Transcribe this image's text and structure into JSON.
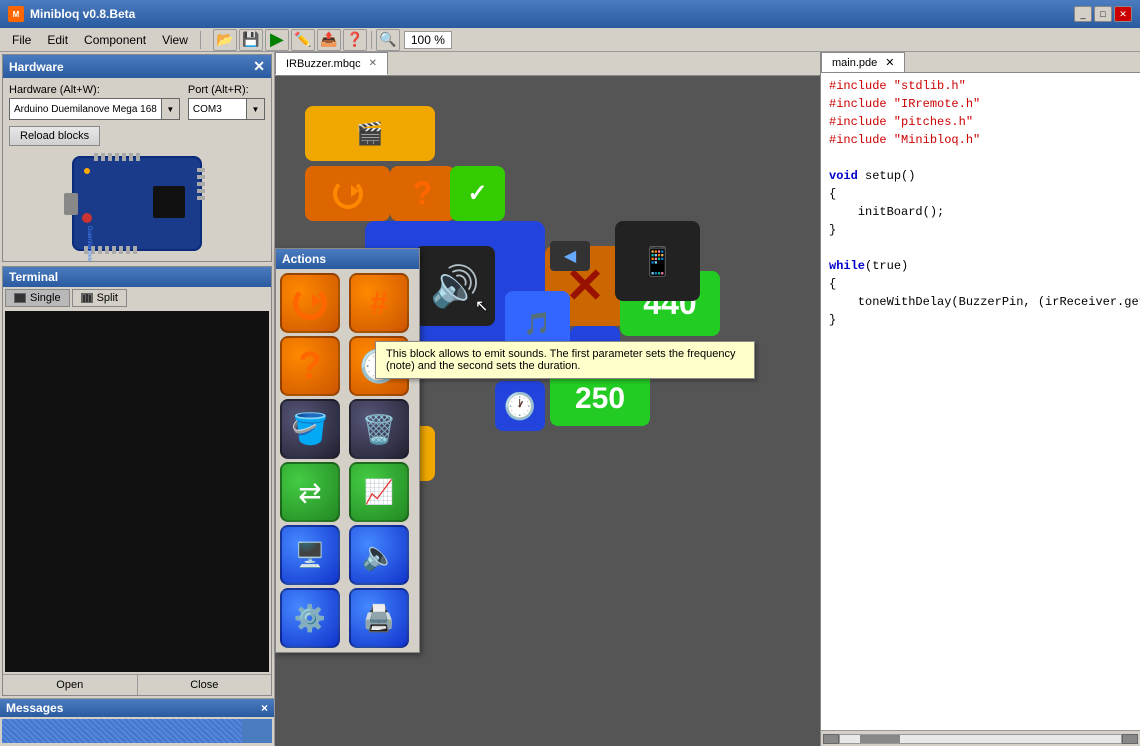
{
  "titlebar": {
    "title": "Minibloq v0.8.Beta",
    "icon": "🔧"
  },
  "menubar": {
    "items": [
      "File",
      "Edit",
      "Component",
      "View"
    ]
  },
  "toolbar": {
    "zoom": "100 %"
  },
  "hardware": {
    "title": "Hardware",
    "hw_label": "Hardware (Alt+W):",
    "hw_value": "Arduino Duemilanove Mega 168",
    "port_label": "Port (Alt+R):",
    "port_value": "COM3",
    "reload_label": "Reload blocks"
  },
  "terminal": {
    "title": "Terminal",
    "tab_single": "Single",
    "tab_split": "Split",
    "btn_open": "Open",
    "btn_close": "Close"
  },
  "messages": {
    "title": "Messages",
    "close": "×"
  },
  "tabs": {
    "editor_tab": "IRBuzzer.mbqc",
    "code_tab": "main.pde"
  },
  "actions": {
    "title": "Actions"
  },
  "code": {
    "lines": [
      "#include \"stdlib.h\"",
      "#include \"IRremote.h\"",
      "#include \"pitches.h\"",
      "#include \"Minibloq.h\"",
      "",
      "void setup()",
      "{",
      "    initBoard();",
      "}",
      "",
      "while(true)",
      "{",
      "    toneWithDelay(BuzzerPin, (irReceiver.getIR",
      "}"
    ]
  },
  "tooltip": {
    "text": "This block allows to emit sounds. The first parameter sets the frequency (note) and the second sets the duration."
  },
  "blocks": {
    "num440": "440",
    "num250": "250"
  }
}
